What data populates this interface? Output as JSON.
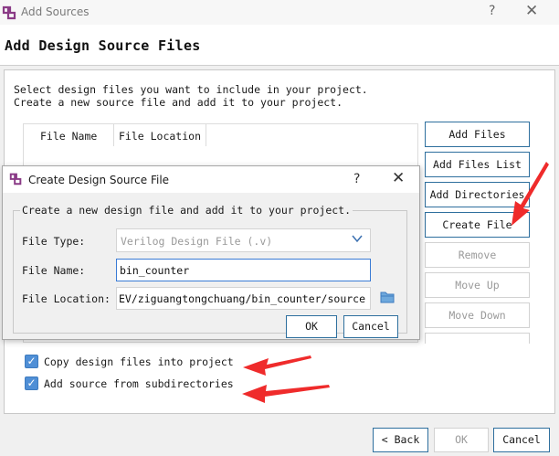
{
  "window": {
    "title": "Add Sources",
    "help": "?",
    "close": "✕"
  },
  "page_title": "Add Design Source Files",
  "description": [
    "Select design files you want to include in your project.",
    "Create a new source file and add it to your project."
  ],
  "table": {
    "columns": [
      "File Name",
      "File Location"
    ]
  },
  "side_buttons": {
    "add_files": "Add Files",
    "add_files_list": "Add Files List",
    "add_directories": "Add Directories",
    "create_file": "Create File",
    "remove": "Remove",
    "move_up": "Move Up",
    "move_down": "Move Down"
  },
  "options": {
    "copy_files": {
      "label": "Copy design files into project",
      "checked": true
    },
    "add_subdirs": {
      "label": "Add source from subdirectories",
      "checked": true
    }
  },
  "footer": {
    "back": "< Back",
    "ok": "OK",
    "cancel": "Cancel"
  },
  "dialog": {
    "title": "Create Design Source File",
    "help": "?",
    "close": "✕",
    "group_label": "Create a new design file and add it to your project.",
    "file_type_label": "File Type:",
    "file_type_value": "Verilog Design File (.v)",
    "file_name_label": "File Name:",
    "file_name_value": "bin_counter",
    "file_location_label": "File Location:",
    "file_location_value": "EV/ziguangtongchuang/bin_counter/source",
    "ok": "OK",
    "cancel": "Cancel"
  },
  "colors": {
    "accent": "#3a7bd5",
    "checkbox": "#4f8fd6",
    "arrow": "#ef2b2b",
    "logo": "#8a3a86"
  },
  "icons": [
    "app-logo-icon",
    "chevron-down-icon",
    "folder-icon",
    "check-icon",
    "red-arrow-annotation"
  ]
}
